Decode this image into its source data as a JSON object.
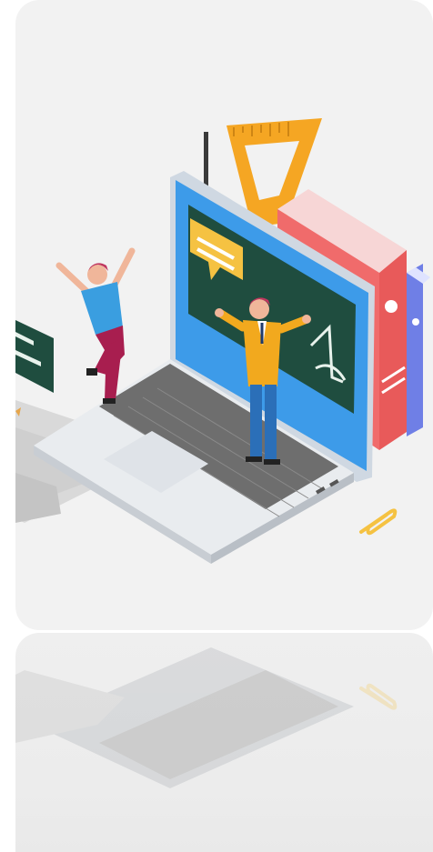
{
  "illustration": {
    "subject": "online-education",
    "colors": {
      "card_background": "#f2f2f2",
      "screen_blue": "#3d9be9",
      "chalkboard_green": "#1f4d3f",
      "ruler_orange": "#f5a623",
      "book_red": "#f06b6b",
      "book_blue": "#6f7fe6",
      "keyboard_gray": "#6e6e6e",
      "teacher_shirt": "#f2a91e",
      "student_shirt": "#3a9ee0",
      "student_pants": "#a81e4f",
      "clip_yellow": "#f5c242"
    }
  }
}
